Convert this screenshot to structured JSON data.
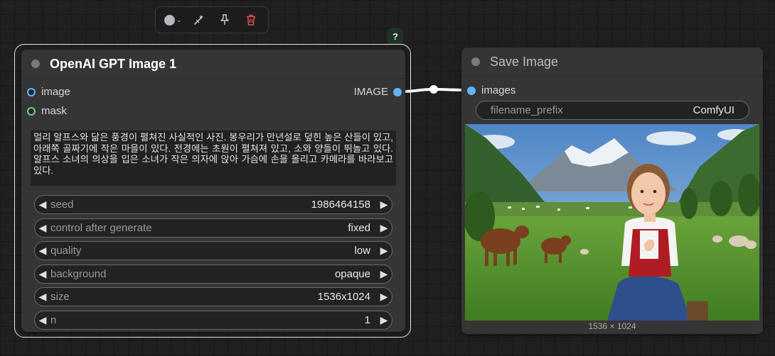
{
  "toolbar": {
    "items": [
      {
        "icon": "color-picker-icon"
      },
      {
        "icon": "bypass-wand-icon"
      },
      {
        "icon": "pin-icon"
      },
      {
        "icon": "trash-icon"
      }
    ],
    "help": "?"
  },
  "gpt_node": {
    "title": "OpenAI GPT Image 1",
    "inputs": [
      {
        "label": "image",
        "color": "#64b5f6"
      },
      {
        "label": "mask",
        "color": "#81c784"
      }
    ],
    "output": {
      "label": "IMAGE",
      "color": "#64b5f6"
    },
    "prompt": "멀리 알프스와 닮은 풍경이 펼쳐진 사실적인 사진. 봉우리가 만년설로 덮힌 높은 산들이 있고, 아래쪽 골짜기에 작은 마을이 있다. 전경에는 초원이 펼쳐져 있고, 소와 양들이 뛰놀고 있다. 알프스 소녀의 의상을 입은 소녀가 작은 의자에 앉아 가슴에 손을 올리고 카메라를 바라보고 있다.",
    "widgets": [
      {
        "label": "seed",
        "value": "1986464158"
      },
      {
        "label": "control after generate",
        "value": "fixed"
      },
      {
        "label": "quality",
        "value": "low"
      },
      {
        "label": "background",
        "value": "opaque"
      },
      {
        "label": "size",
        "value": "1536x1024"
      },
      {
        "label": "n",
        "value": "1"
      }
    ]
  },
  "save_node": {
    "title": "Save Image",
    "input": {
      "label": "images",
      "color": "#64b5f6"
    },
    "filename_prefix": {
      "label": "filename_prefix",
      "value": "ComfyUI"
    },
    "image_size": "1536 × 1024"
  },
  "colors": {
    "canvas": "#202020",
    "node_body": "#353535",
    "widget_bg": "#222222",
    "link": "#ffffff",
    "delete": "#e05050"
  }
}
